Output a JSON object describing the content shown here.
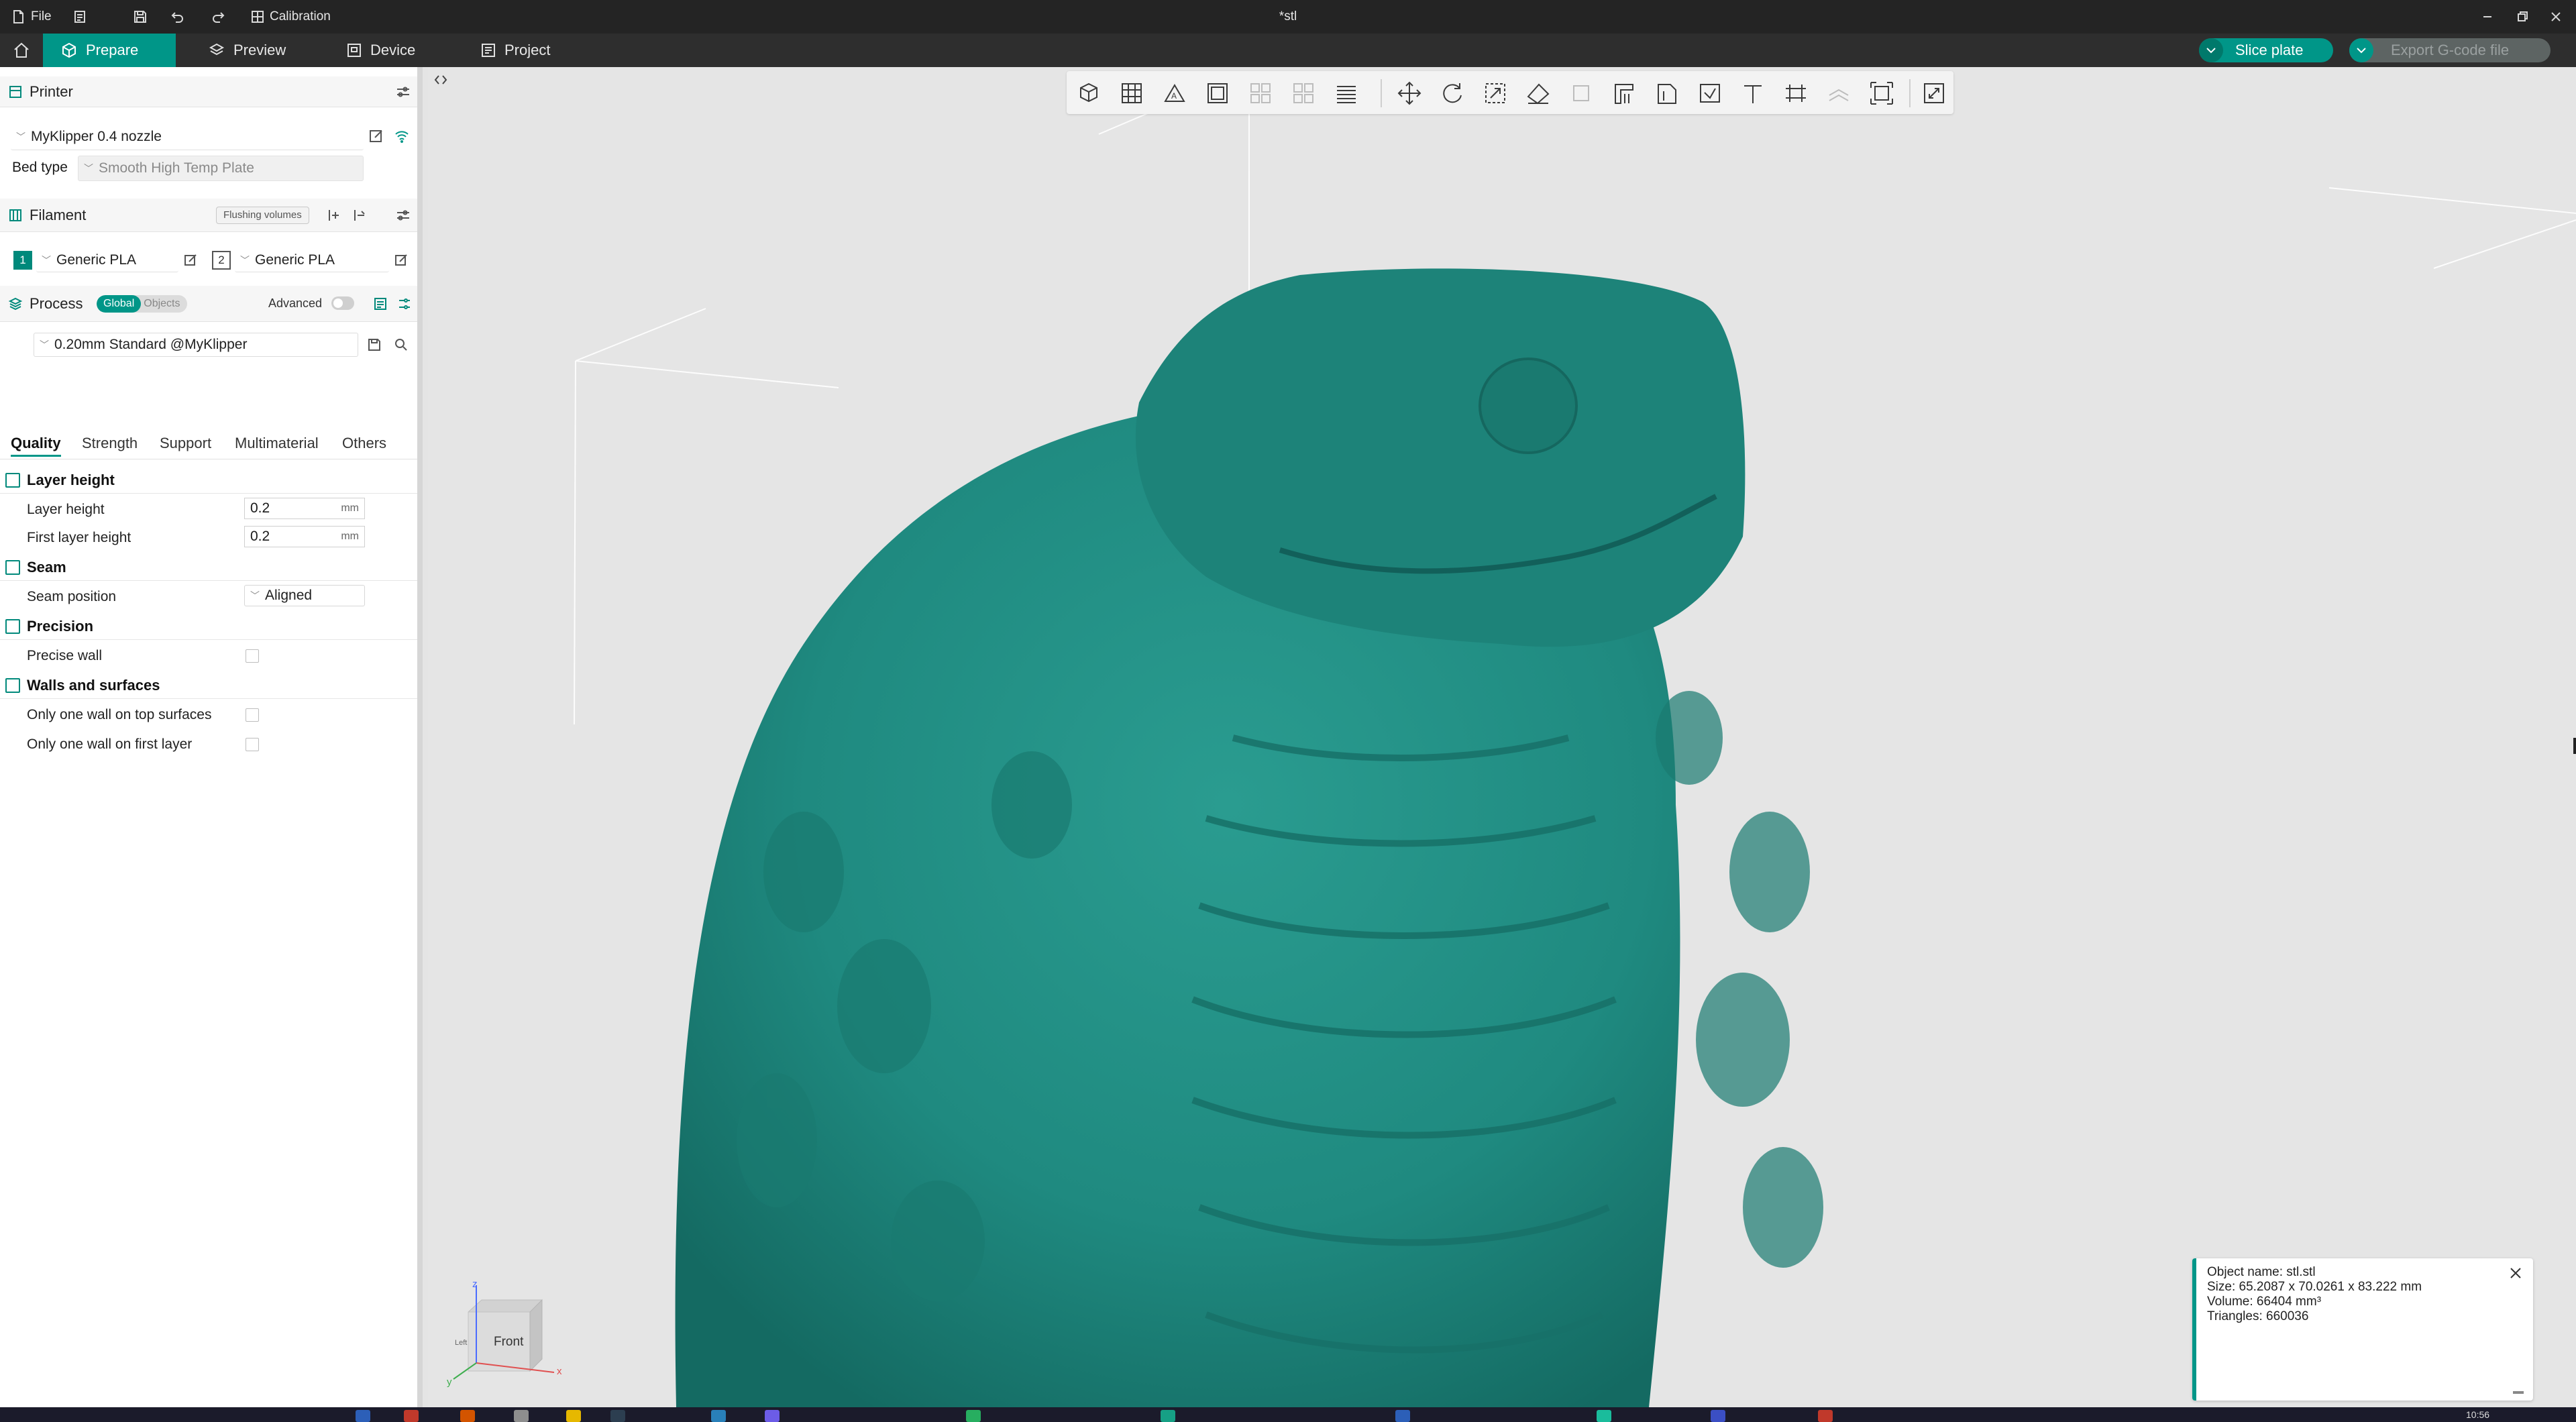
{
  "titlebar": {
    "file_label": "File",
    "calibration_label": "Calibration",
    "doc_title": "*stl"
  },
  "nav": {
    "tabs": [
      {
        "label": "Prepare",
        "active": true
      },
      {
        "label": "Preview",
        "active": false
      },
      {
        "label": "Device",
        "active": false
      },
      {
        "label": "Project",
        "active": false
      }
    ],
    "slice_label": "Slice plate",
    "export_label": "Export G-code file"
  },
  "sidebar": {
    "printer": {
      "title": "Printer",
      "name": "MyKlipper 0.4 nozzle",
      "bed_type_label": "Bed type",
      "bed_type_value": "Smooth High Temp Plate"
    },
    "filament": {
      "title": "Filament",
      "flushing_label": "Flushing volumes",
      "slots": [
        {
          "index": "1",
          "name": "Generic PLA"
        },
        {
          "index": "2",
          "name": "Generic PLA"
        }
      ]
    },
    "process": {
      "title": "Process",
      "global_label": "Global",
      "objects_label": "Objects",
      "advanced_label": "Advanced",
      "preset": "0.20mm Standard @MyKlipper"
    },
    "tabs": [
      "Quality",
      "Strength",
      "Support",
      "Multimaterial",
      "Others"
    ],
    "groups": {
      "layer_height": {
        "title": "Layer height",
        "layer_height_label": "Layer height",
        "layer_height_value": "0.2",
        "first_layer_label": "First layer height",
        "first_layer_value": "0.2",
        "unit": "mm"
      },
      "seam": {
        "title": "Seam",
        "position_label": "Seam position",
        "position_value": "Aligned"
      },
      "precision": {
        "title": "Precision",
        "precise_wall_label": "Precise wall"
      },
      "walls": {
        "title": "Walls and surfaces",
        "top_label": "Only one wall on top surfaces",
        "first_label": "Only one wall on first layer"
      }
    }
  },
  "viewport": {
    "model_color": "#1f8a80",
    "axis_cube": {
      "face_label": "Front",
      "x": "x",
      "y": "y",
      "z": "z",
      "left_label": "Left"
    }
  },
  "info": {
    "name": "Object name: stl.stl",
    "size": "Size: 65.2087 x 70.0261 x 83.222 mm",
    "volume": "Volume: 66404 mm³",
    "triangles": "Triangles: 660036"
  },
  "colors": {
    "accent": "#009688",
    "titlebar": "#242424",
    "navbar": "#2e2e2e"
  },
  "taskbar": {
    "clock": "10:56"
  }
}
